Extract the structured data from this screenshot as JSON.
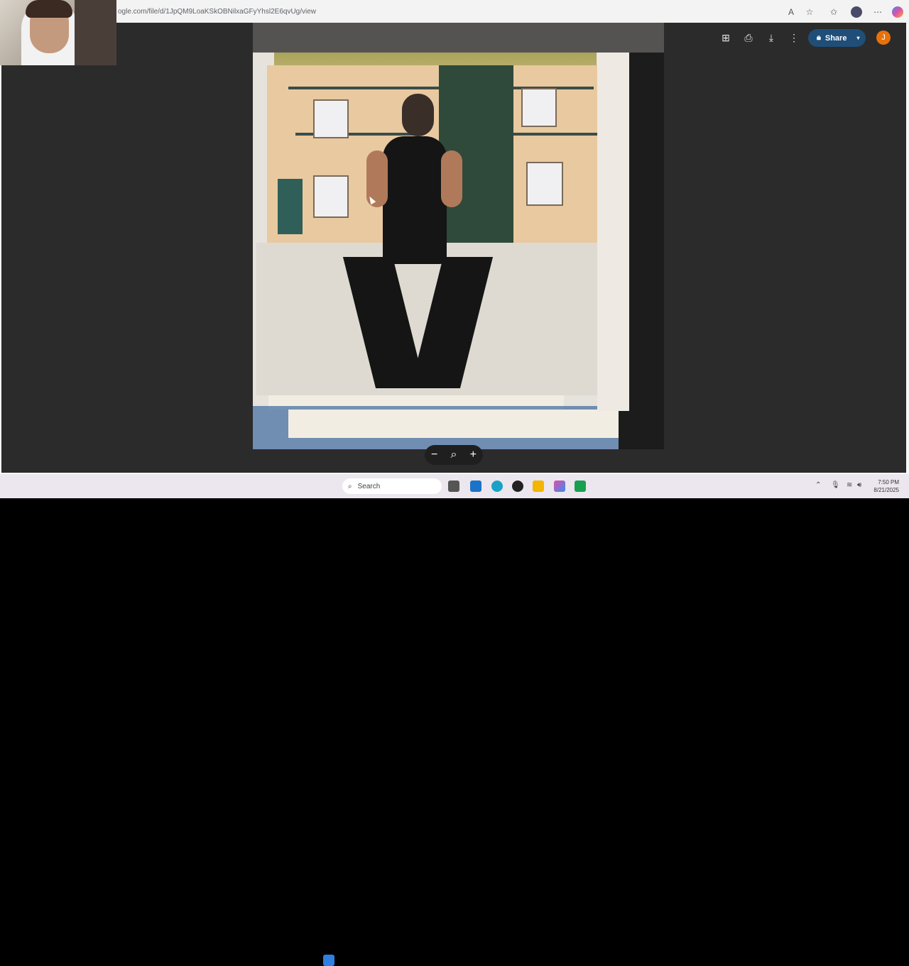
{
  "browser": {
    "url": "ogle.com/file/d/1JpQM9LoaKSkOBNilxaGFyYhsl2E6qvUg/view"
  },
  "toolbar": {
    "add_icon": "add-to-drive-icon",
    "print_icon": "print-icon",
    "download_icon": "download-icon",
    "more_icon": "more-options-icon",
    "share_label": "Share",
    "avatar_initial": "J"
  },
  "zoom": {
    "minus": "−",
    "plus": "+"
  },
  "taskbar": {
    "search_label": "Search",
    "time": "7:50 PM",
    "date": "8/21/2025"
  },
  "colors": {
    "share_button": "#1f4e79",
    "avatar": "#e8710a",
    "viewer_bg": "#2b2b2b"
  }
}
